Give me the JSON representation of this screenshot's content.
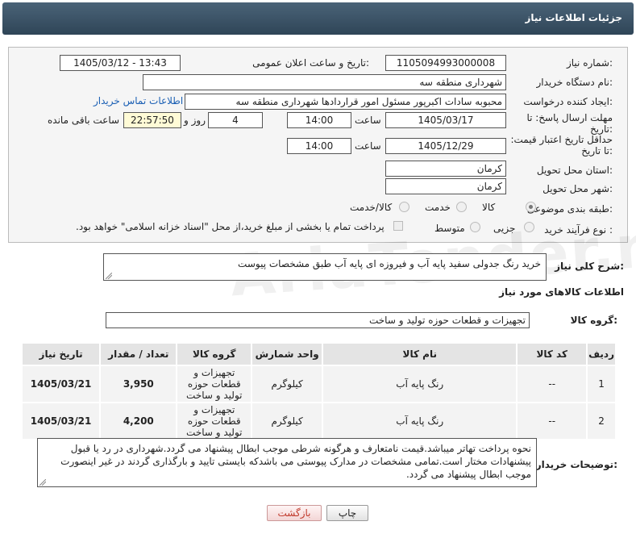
{
  "header": {
    "title": "جزئیات اطلاعات نیاز"
  },
  "form": {
    "need_number": {
      "label": "شماره نیاز:",
      "value": "1105094993000008"
    },
    "announce_datetime": {
      "label": "تاریخ و ساعت اعلان عمومی:",
      "value": "1405/03/12 - 13:43"
    },
    "buyer_org": {
      "label": "نام دستگاه خریدار:",
      "value": "شهرداری منطقه سه"
    },
    "requester": {
      "label": "ایجاد کننده درخواست:",
      "value": "محبوبه سادات اکبرپور مسئول امور قراردادها شهرداری منطقه سه",
      "contact_link": "اطلاعات تماس خریدار"
    },
    "reply_deadline": {
      "label": "مهلت ارسال پاسخ: تا تاریخ:",
      "date": "1405/03/17",
      "time_label": "ساعت",
      "time": "14:00",
      "days": "4",
      "days_label": "روز و",
      "remaining": "22:57:50",
      "remaining_label": "ساعت باقی مانده"
    },
    "price_validity": {
      "label": "حداقل تاریخ اعتبار قیمت: تا تاریخ:",
      "date": "1405/12/29",
      "time_label": "ساعت",
      "time": "14:00"
    },
    "province": {
      "label": "استان محل تحویل:",
      "value": "کرمان"
    },
    "city": {
      "label": "شهر محل تحویل:",
      "value": "کرمان"
    },
    "category": {
      "label": "طبقه بندی موضوعی:",
      "options": [
        "کالا",
        "خدمت",
        "کالا/خدمت"
      ],
      "selected": "کالا"
    },
    "purchase_type": {
      "label": "نوع فرآیند خرید :",
      "options": [
        "جزیی",
        "متوسط"
      ],
      "selected": "",
      "note": "پرداخت تمام یا بخشی از مبلغ خرید،از محل \"اسناد خزانه اسلامی\" خواهد بود."
    }
  },
  "summary": {
    "label": "شرح کلی نیاز:",
    "value": "خرید رنگ جدولی سفید پایه آب و فیروزه ای پایه آب طبق مشخصات پیوست"
  },
  "goods": {
    "section_title": "اطلاعات کالاهای مورد نیاز",
    "group_label": "گروه کالا:",
    "group_value": "تجهیزات و قطعات حوزه تولید و ساخت",
    "columns": [
      "ردیف",
      "کد کالا",
      "نام کالا",
      "واحد شمارش",
      "گروه کالا",
      "تعداد / مقدار",
      "تاریخ نیاز"
    ],
    "rows": [
      {
        "index": "1",
        "code": "--",
        "name": "رنگ پایه آب",
        "unit": "کیلوگرم",
        "group": "تجهیزات و قطعات حوزه تولید و ساخت",
        "qty": "3,950",
        "date": "1405/03/21"
      },
      {
        "index": "2",
        "code": "--",
        "name": "رنگ پایه آب",
        "unit": "کیلوگرم",
        "group": "تجهیزات و قطعات حوزه تولید و ساخت",
        "qty": "4,200",
        "date": "1405/03/21"
      }
    ]
  },
  "buyer_notes": {
    "label": "توضیحات خریدار:",
    "value": "نحوه پرداخت تهاتر میباشد.قیمت نامتعارف و هرگونه شرطی موجب ابطال پیشنهاد می گردد.شهرداری در رد یا قبول پیشنهادات مختار است.تمامی مشخصات در مدارک پیوستی می باشدکه بایستی تایید و بارگذاری گردند در غیر اینصورت موجب ابطال پیشنهاد می گردد."
  },
  "buttons": {
    "print": "چاپ",
    "back": "بازگشت"
  },
  "watermark": "AriaTender.net",
  "colors": {
    "titlebar": "#3b5266",
    "link": "#1a5fb4",
    "remaining_bg": "#fffbd6",
    "back_text": "#c0392b"
  }
}
